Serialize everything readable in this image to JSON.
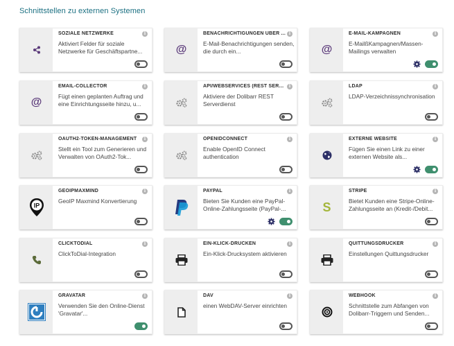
{
  "page": {
    "title": "Schnittstellen zu externen Systemen"
  },
  "colors": {
    "accent_purple": "#5b3a7a",
    "toggle_on": "#3f8f6e",
    "title": "#1a6f81"
  },
  "modules": [
    {
      "name": "SOZIALE NETZWERKE",
      "desc": "Aktiviert Felder für soziale Netzwerke für Geschäftspartne...",
      "icon": "share-icon",
      "enabled": false,
      "has_settings": false
    },
    {
      "name": "BENACHRICHTIGUNGEN ÜBER ...",
      "desc": "E-Mail-Benachrichtigungen senden, die durch ein...",
      "icon": "at-icon",
      "enabled": false,
      "has_settings": false
    },
    {
      "name": "E-MAIL-KAMPAGNEN",
      "desc": "E-MailßKampagnen/Massen-Mailings verwalten",
      "icon": "at-icon",
      "enabled": true,
      "has_settings": true
    },
    {
      "name": "EMAIL-COLLECTOR",
      "desc": "Fügt einen geplanten Auftrag und eine Einrichtungsseite hinzu, u...",
      "icon": "at-icon",
      "enabled": false,
      "has_settings": false
    },
    {
      "name": "API/WEBSERVICES (REST SERV...",
      "desc": "Aktiviere der Dolibarr REST Serverdienst",
      "icon": "gears-icon",
      "enabled": false,
      "has_settings": false
    },
    {
      "name": "LDAP",
      "desc": "LDAP-Verzeichnissynchronisation",
      "icon": "gears-icon",
      "enabled": false,
      "has_settings": false
    },
    {
      "name": "OAUTH2-TOKEN-MANAGEMENT",
      "desc": "Stellt ein Tool zum Generieren und Verwalten von OAuth2-Tok...",
      "icon": "gears-icon",
      "enabled": false,
      "has_settings": false
    },
    {
      "name": "OPENIDCONNECT",
      "desc": "Enable OpenID Connect authentication",
      "icon": "gears-icon",
      "enabled": false,
      "has_settings": false
    },
    {
      "name": "EXTERNE WEBSITE",
      "desc": "Fügen Sie einen Link zu einer externen Website als...",
      "icon": "globe-icon",
      "enabled": true,
      "has_settings": true
    },
    {
      "name": "GEOIPMAXMIND",
      "desc": "GeoIP Maxmind Konvertierung",
      "icon": "geoip-pin-icon",
      "enabled": false,
      "has_settings": false
    },
    {
      "name": "PAYPAL",
      "desc": "Bieten Sie Kunden eine PayPal-Online-Zahlungsseite (PayPal-...",
      "icon": "paypal-logo-icon",
      "enabled": true,
      "has_settings": true
    },
    {
      "name": "STRIPE",
      "desc": "Bietet Kunden eine Stripe-Online-Zahlungsseite an (Kredit-/Debit...",
      "icon": "stripe-logo-icon",
      "enabled": false,
      "has_settings": false
    },
    {
      "name": "CLICKTODIAL",
      "desc": "ClickToDial-Integration",
      "icon": "phone-icon",
      "enabled": false,
      "has_settings": false
    },
    {
      "name": "EIN-KLICK-DRUCKEN",
      "desc": "Ein-Klick-Drucksystem aktivieren",
      "icon": "printer-icon",
      "enabled": false,
      "has_settings": false
    },
    {
      "name": "QUITTUNGSDRUCKER",
      "desc": "Einstellungen Quittungsdrucker",
      "icon": "printer-icon",
      "enabled": false,
      "has_settings": false
    },
    {
      "name": "GRAVATAR",
      "desc": "Verwenden Sie den Online-Dienst 'Gravatar'...",
      "icon": "gravatar-logo-icon",
      "enabled": true,
      "has_settings": false
    },
    {
      "name": "DAV",
      "desc": "einen WebDAV-Server einrichten",
      "icon": "file-icon",
      "enabled": false,
      "has_settings": false
    },
    {
      "name": "WEBHOOK",
      "desc": "Schnittstelle zum Abfangen von Dolibarr-Triggern und Senden...",
      "icon": "target-icon",
      "enabled": false,
      "has_settings": false
    }
  ],
  "info_glyph": "i"
}
